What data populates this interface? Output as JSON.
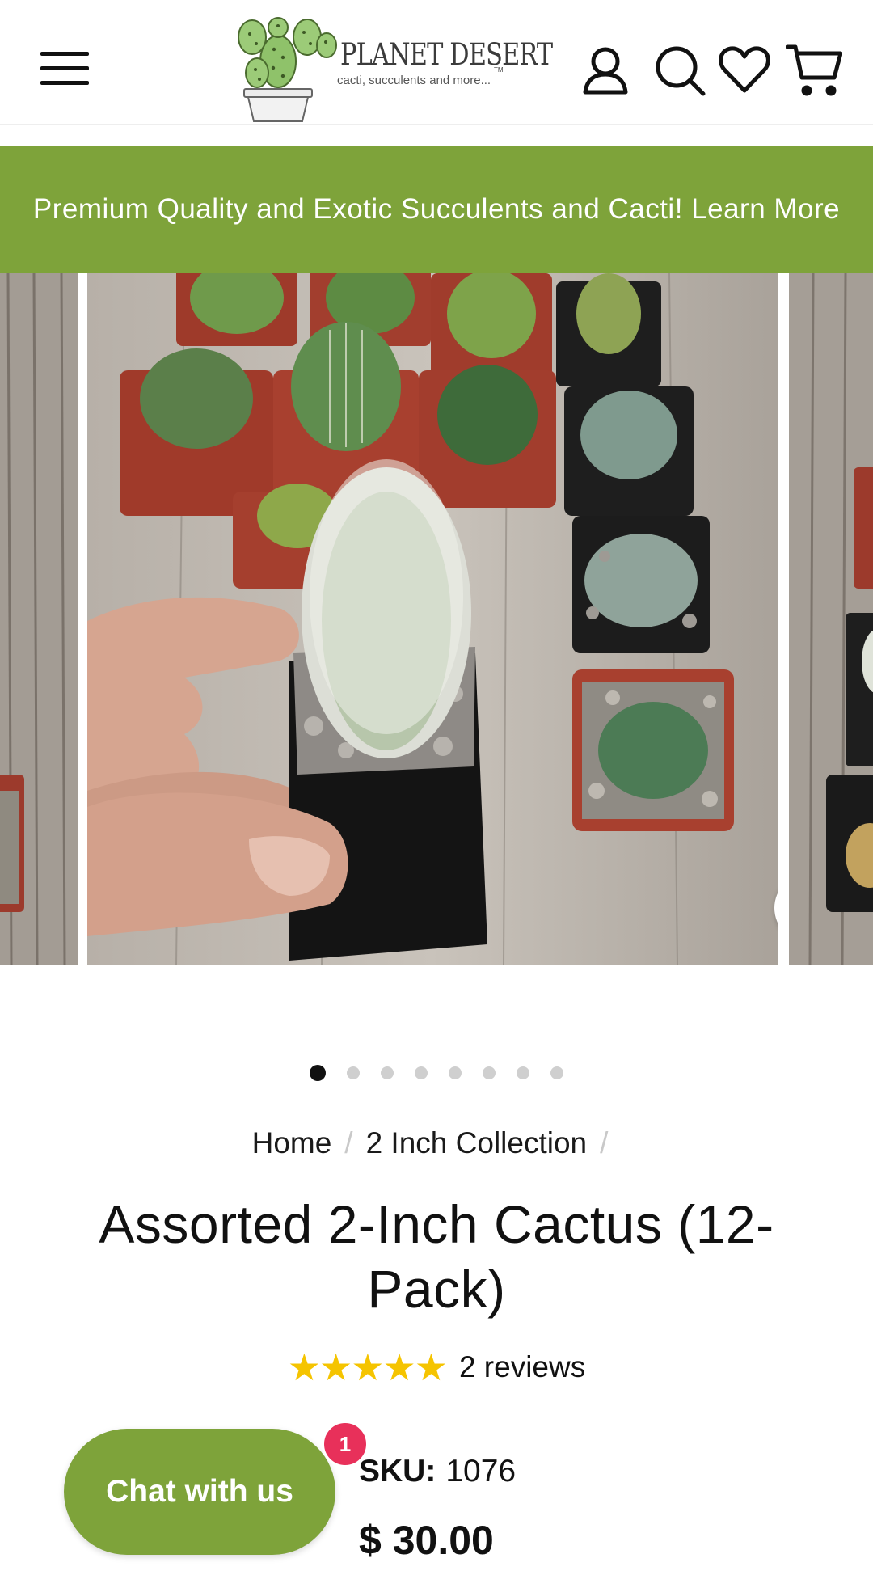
{
  "header": {
    "logo_title": "PLANET DESERT",
    "logo_tm": "TM",
    "logo_subtitle": "cacti, succulents and more..."
  },
  "announcement": {
    "text": "Premium Quality and Exotic Succulents and Cacti! Learn More"
  },
  "gallery": {
    "slide_count": 8,
    "active_index": 0
  },
  "breadcrumb": {
    "items": [
      "Home",
      "2 Inch Collection"
    ],
    "separator": "/"
  },
  "product": {
    "title": "Assorted 2-Inch Cactus (12-Pack)",
    "rating": 5,
    "stars": "★★★★★",
    "reviews_label": "2 reviews",
    "sku_label": "SKU:",
    "sku_value": "1076",
    "price": "$ 30.00"
  },
  "chat": {
    "label": "Chat with us",
    "badge": "1"
  },
  "colors": {
    "brand_green": "#7ea33a",
    "star_yellow": "#f5c400",
    "badge_pink": "#e8305a"
  }
}
